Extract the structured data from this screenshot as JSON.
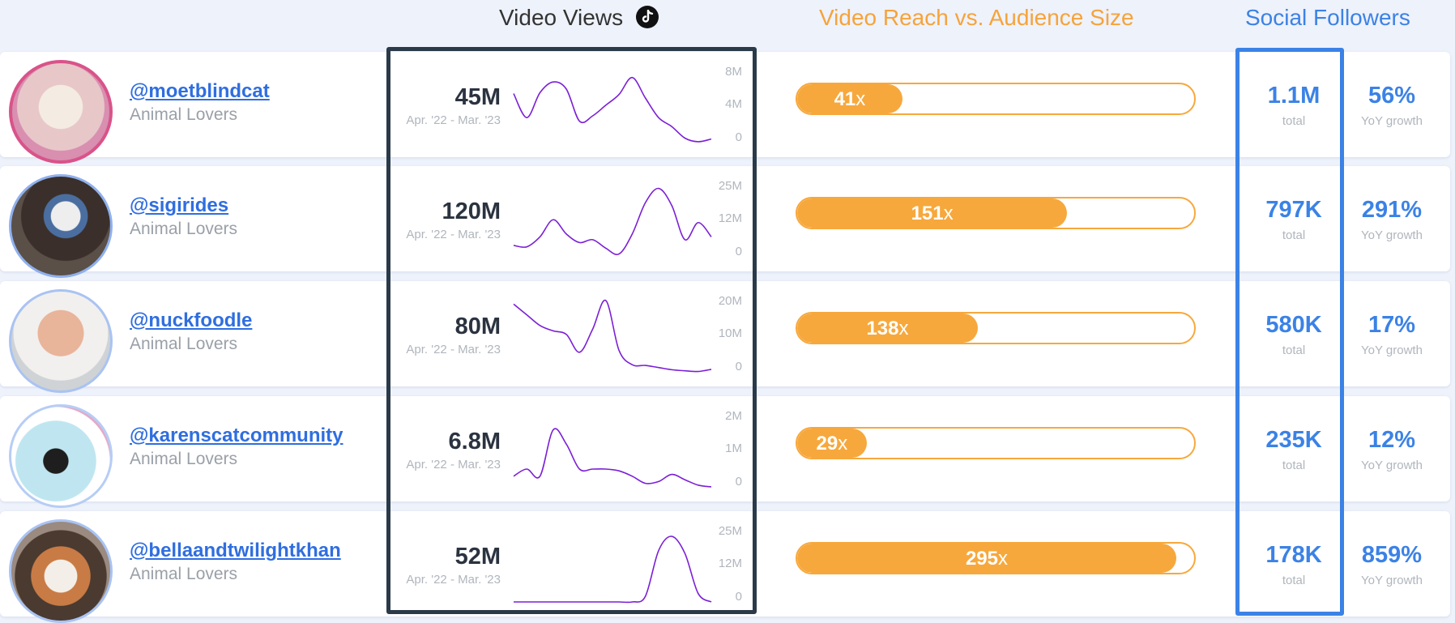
{
  "headers": {
    "video_views": "Video Views",
    "reach": "Video Reach vs. Audience Size",
    "social": "Social Followers"
  },
  "icons": {
    "tiktok": "tiktok-icon"
  },
  "colors": {
    "accent_orange": "#f7a83c",
    "accent_blue": "#3b82e6",
    "sparkline": "#7b1fd6",
    "frame_dark": "#2b3a48"
  },
  "rows": [
    {
      "handle": "@moetblindcat",
      "category": "Animal Lovers",
      "views": "45M",
      "date_range": "Apr. '22 - Mar. '23",
      "ticks": [
        "8M",
        "4M",
        "0"
      ],
      "spark": [
        5.5,
        2.8,
        5.6,
        6.8,
        6.0,
        2.4,
        3.0,
        4.2,
        5.4,
        7.3,
        5.0,
        2.8,
        1.8,
        0.5,
        0.1,
        0.4
      ],
      "spark_max": 8,
      "reach_multiplier": "41",
      "reach_suffix": "x",
      "reach_fill": 0.265,
      "followers": "1.1M",
      "followers_sub": "total",
      "growth": "56%",
      "growth_sub": "YoY growth"
    },
    {
      "handle": "@sigirides",
      "category": "Animal Lovers",
      "views": "120M",
      "date_range": "Apr. '22 - Mar. '23",
      "ticks": [
        "25M",
        "12M",
        "0"
      ],
      "spark": [
        4,
        3.5,
        7,
        13,
        8,
        5,
        6,
        3,
        1,
        8,
        19,
        24,
        18,
        6,
        12,
        7
      ],
      "spark_max": 25,
      "reach_multiplier": "151",
      "reach_suffix": "x",
      "reach_fill": 0.68,
      "followers": "797K",
      "followers_sub": "total",
      "growth": "291%",
      "growth_sub": "YoY growth"
    },
    {
      "handle": "@nuckfoodle",
      "category": "Animal Lovers",
      "views": "80M",
      "date_range": "Apr. '22 - Mar. '23",
      "ticks": [
        "20M",
        "10M",
        "0"
      ],
      "spark": [
        19,
        16,
        13,
        11.5,
        10.5,
        5.5,
        12,
        20,
        6,
        2,
        1.8,
        1.2,
        0.6,
        0.3,
        0.1,
        0.7
      ],
      "spark_max": 20,
      "reach_multiplier": "138",
      "reach_suffix": "x",
      "reach_fill": 0.455,
      "followers": "580K",
      "followers_sub": "total",
      "growth": "17%",
      "growth_sub": "YoY growth"
    },
    {
      "handle": "@karenscatcommunity",
      "category": "Animal Lovers",
      "views": "6.8M",
      "date_range": "Apr. '22 - Mar. '23",
      "ticks": [
        "2M",
        "1M",
        "0"
      ],
      "spark": [
        0.3,
        0.5,
        0.3,
        1.6,
        1.2,
        0.5,
        0.5,
        0.5,
        0.45,
        0.3,
        0.1,
        0.15,
        0.35,
        0.2,
        0.05,
        0.0
      ],
      "spark_max": 2,
      "reach_multiplier": "29",
      "reach_suffix": "x",
      "reach_fill": 0.175,
      "followers": "235K",
      "followers_sub": "total",
      "growth": "12%",
      "growth_sub": "YoY growth"
    },
    {
      "handle": "@bellaandtwilightkhan",
      "category": "Animal Lovers",
      "views": "52M",
      "date_range": "Apr. '22 - Mar. '23",
      "ticks": [
        "25M",
        "12M",
        "0"
      ],
      "spark": [
        0,
        0,
        0,
        0,
        0,
        0,
        0,
        0,
        0,
        0,
        2,
        18,
        23,
        17,
        3,
        0
      ],
      "spark_max": 25,
      "reach_multiplier": "295",
      "reach_suffix": "x",
      "reach_fill": 0.955,
      "followers": "178K",
      "followers_sub": "total",
      "growth": "859%",
      "growth_sub": "YoY growth"
    }
  ]
}
